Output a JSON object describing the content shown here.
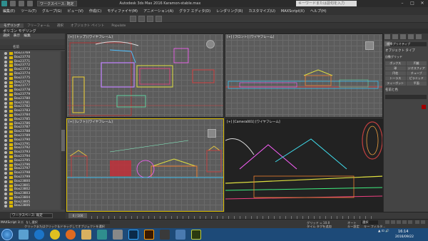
{
  "titlebar": {
    "workspace": "ワークスペース: 既定",
    "title": "Autodesk 3ds Max 2016   Karamon-stable.max",
    "search_placeholder": "キーワードまたは語句を入力"
  },
  "menu": [
    "編集(E)",
    "ツール(T)",
    "グループ(G)",
    "ビュー(V)",
    "作成(C)",
    "モディファイヤ(M)",
    "アニメーション(A)",
    "グラフ エディタ(D)",
    "レンダリング(R)",
    "カスタマイズ(U)",
    "MAXScript(X)",
    "ヘルプ(H)"
  ],
  "ribbon": {
    "tabs": [
      "モデリング",
      "フリーフォーム",
      "選択",
      "オブジェクト ペイント",
      "Populate"
    ],
    "active_tab": "モデリング",
    "subpanel": "ポリゴン モデリング"
  },
  "explorer": {
    "menu": [
      "選択",
      "表示",
      "編集"
    ],
    "column": "名前",
    "items": [
      "Box23769",
      "Box23770",
      "Box23771",
      "Box23772",
      "Box23773",
      "Box23774",
      "Box23775",
      "Box23776",
      "Box23777",
      "Box23778",
      "Box23779",
      "Box23780",
      "Box23781",
      "Box23782",
      "Box23783",
      "Box23784",
      "Box23785",
      "Box23786",
      "Box23787",
      "Box23788",
      "Box23789",
      "Box23790",
      "Box23791",
      "Box23792",
      "Box23793",
      "Box23794",
      "Box23795",
      "Box23796",
      "Box23797",
      "Box23798",
      "Box23799",
      "Box23800",
      "Box23801",
      "Box23802",
      "Box23803",
      "Box23804",
      "Box23805",
      "Box23806"
    ]
  },
  "viewports": {
    "top": "[+] [トップ] [ワイヤフレーム]",
    "front": "[+] [フロント] [ワイヤフレーム]",
    "left": "[+] [レフト] [ワイヤフレーム]",
    "camera": "[+] [Camera001] [ワイヤフレーム]"
  },
  "command_panel": {
    "category": "標準プリミティブ",
    "rollout": "オブジェクト タイプ",
    "autogrid": "自動グリッド",
    "buttons": [
      "ボックス",
      "円錐",
      "球",
      "ジオスフィア",
      "円柱",
      "チューブ",
      "トーラス",
      "ピラミッド",
      "ティーポット",
      "平面"
    ],
    "name_color": "名前と色"
  },
  "timeline": {
    "frame": "0 / 100"
  },
  "workspace_bar": {
    "label": "ワークスペース: 既定"
  },
  "status": {
    "maxscript": "MAXScript ミニ",
    "message": "なし選択",
    "hint": "クリックまたはクリック＆ドラッグしてオブジェクトを選択",
    "grid": "グリッド = 10.0",
    "add_time_tag": "タイム タグを追加",
    "auto_key": "オート",
    "auto_key_value": "選択",
    "set_key": "キー設定",
    "key_filter": "キー フィルタ..."
  },
  "taskbar": {
    "time": "16:14",
    "date": "2016/09/22",
    "apps": [
      "explorer",
      "ie",
      "chrome",
      "firefox",
      "folder",
      "3dsmax",
      "app",
      "photoshop",
      "illustrator",
      "app2",
      "app3",
      "muse"
    ]
  },
  "colors": {
    "accent": "#d4b800",
    "taskbar": "#1d4a78"
  }
}
